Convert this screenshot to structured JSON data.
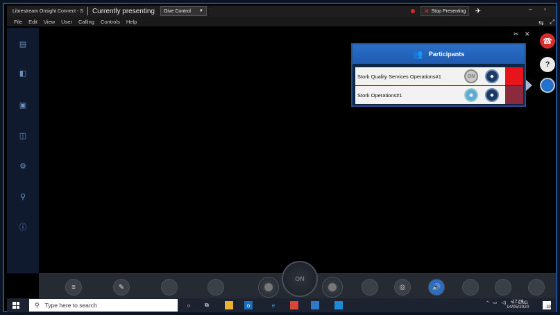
{
  "titlebar": {
    "app_title": "Librestream Onsight Connect - S",
    "presenting": "Currently presenting",
    "give_control": "Give Control",
    "stop_presenting": "Stop Presenting"
  },
  "menu": [
    "File",
    "Edit",
    "View",
    "User",
    "Calling",
    "Controls",
    "Help"
  ],
  "participants": {
    "title": "Participants",
    "rows": [
      {
        "name": "Stork Quality Services Operations#1",
        "status_color": "#e8141c",
        "badge": "ON"
      },
      {
        "name": "Stork Operations#1",
        "status_color": "#8b2a3c",
        "badge": ""
      }
    ]
  },
  "toolbar": {
    "dial_label": "ON"
  },
  "taskbar": {
    "search_placeholder": "Type here to search",
    "lang": "ENG",
    "time": "12:16",
    "date": "14/05/2020",
    "notifications": "30"
  },
  "colors": {
    "accent": "#1f5bb0",
    "end_call": "#d32f2f",
    "stop": "#e53935"
  }
}
